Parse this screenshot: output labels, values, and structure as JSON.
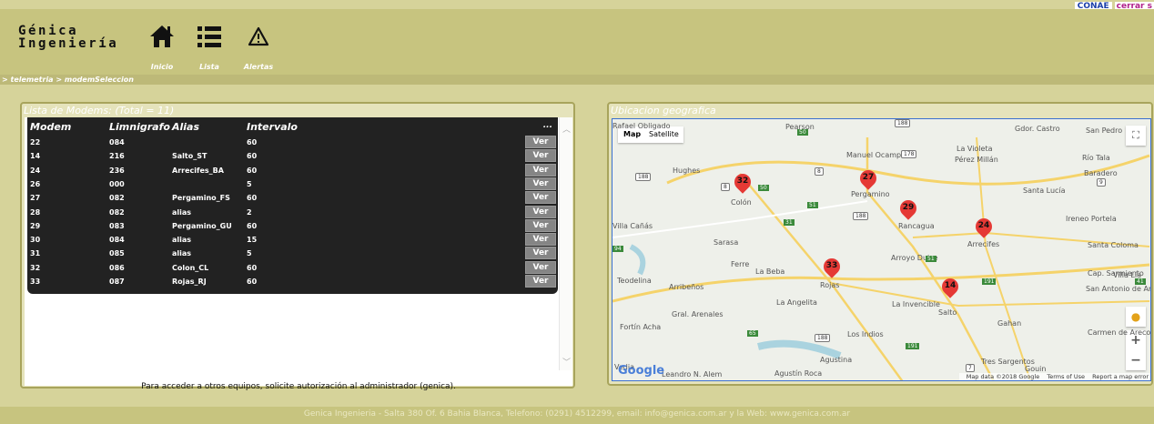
{
  "top_links": {
    "conae": "CONAE",
    "logout": "cerrar s"
  },
  "logo": {
    "line1": "Génica",
    "line2": "Ingeniería"
  },
  "nav": [
    {
      "label": "Inicio",
      "icon": "home-icon"
    },
    {
      "label": "Lista",
      "icon": "list-icon"
    },
    {
      "label": "Alertas",
      "icon": "warning-icon"
    }
  ],
  "breadcrumb": "> telemetria > modemSeleccion",
  "modems_panel": {
    "title": "Lista de Modems: (Total = 11)",
    "columns": [
      "Modem",
      "Limnigrafo",
      "Alias",
      "Intervalo"
    ],
    "menu_dots": "...",
    "ver_label": "Ver",
    "rows": [
      {
        "modem": "22",
        "limnigrafo": "084",
        "alias": "",
        "intervalo": "60"
      },
      {
        "modem": "14",
        "limnigrafo": "216",
        "alias": "Salto_ST",
        "intervalo": "60"
      },
      {
        "modem": "24",
        "limnigrafo": "236",
        "alias": "Arrecifes_BA",
        "intervalo": "60"
      },
      {
        "modem": "26",
        "limnigrafo": "000",
        "alias": "",
        "intervalo": "5"
      },
      {
        "modem": "27",
        "limnigrafo": "082",
        "alias": "Pergamino_FS",
        "intervalo": "60"
      },
      {
        "modem": "28",
        "limnigrafo": "082",
        "alias": "alias",
        "intervalo": "2"
      },
      {
        "modem": "29",
        "limnigrafo": "083",
        "alias": "Pergamino_GU",
        "intervalo": "60"
      },
      {
        "modem": "30",
        "limnigrafo": "084",
        "alias": "alias",
        "intervalo": "15"
      },
      {
        "modem": "31",
        "limnigrafo": "085",
        "alias": "alias",
        "intervalo": "5"
      },
      {
        "modem": "32",
        "limnigrafo": "086",
        "alias": "Colon_CL",
        "intervalo": "60"
      },
      {
        "modem": "33",
        "limnigrafo": "087",
        "alias": "Rojas_RJ",
        "intervalo": "60"
      }
    ],
    "note": "Para acceder a otros equipos, solicite autorización al administrador (genica)."
  },
  "map_panel": {
    "title": "Ubicacion geografica",
    "map_type_buttons": [
      "Map",
      "Satellite"
    ],
    "google_logo": "Google",
    "attribution": [
      "Map data ©2018 Google",
      "Terms of Use",
      "Report a map error"
    ],
    "markers": [
      "32",
      "27",
      "29",
      "24",
      "33",
      "14"
    ],
    "towns": [
      "Pearson",
      "Gdor. Castro",
      "San Pedro",
      "Manuel Ocampo",
      "La Violeta",
      "Pérez Millán",
      "Río Tala",
      "Baradero",
      "Hughes",
      "Colón",
      "Pergamino",
      "Santa Lucía",
      "Ireneo Portela",
      "Rancagua",
      "Sarasa",
      "Arrecifes",
      "Santa Coloma",
      "Arroyo Dulce",
      "Ferre",
      "La Beba",
      "Cap. Sarmiento",
      "Villa Lía",
      "Teodelina",
      "Arribeños",
      "Rojas",
      "San Antonio de Areco",
      "La Angelita",
      "La Invencible",
      "Salto",
      "Gral. Arenales",
      "Gahan",
      "Fortín Acha",
      "Los Indios",
      "Carmen de Areco",
      "Agustina",
      "Tres Sargentos",
      "Agustín Roca",
      "Leandro N. Alem",
      "Gouin",
      "Vedia",
      "Villa Cañás",
      "Rafael Obligado"
    ],
    "route_shields": [
      "188",
      "178",
      "8",
      "188",
      "8",
      "51",
      "188",
      "31",
      "94",
      "51",
      "191",
      "191",
      "65",
      "188",
      "191",
      "7",
      "41",
      "9",
      "50",
      "50"
    ]
  },
  "footer": "Genica Ingenieria - Salta 380 Of. 6 Bahia Blanca, Telefono: (0291) 4512299, email: info@genica.com.ar y la Web: www.genica.com.ar"
}
